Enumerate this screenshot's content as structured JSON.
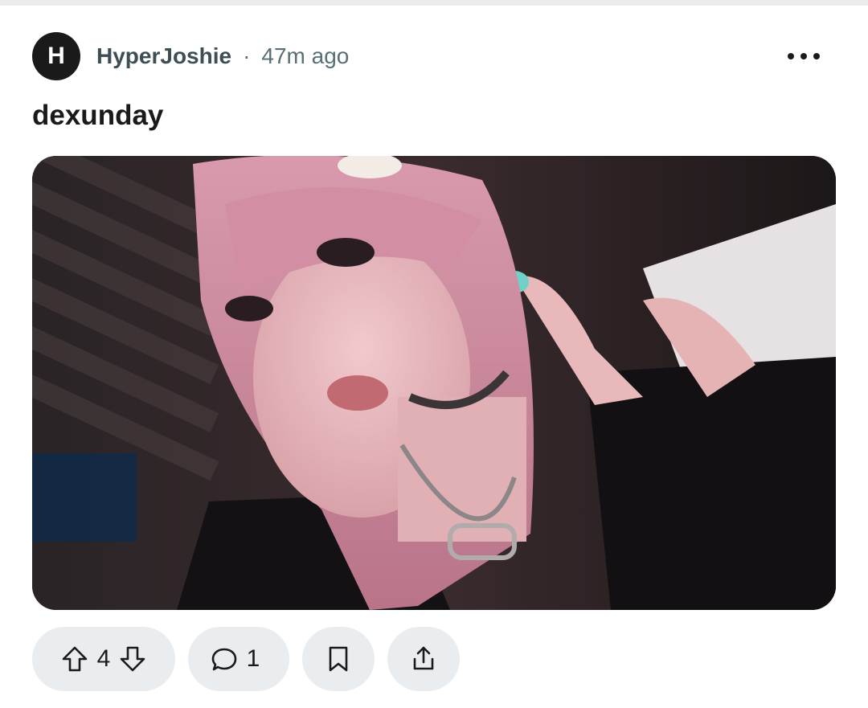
{
  "post": {
    "author_initial": "H",
    "author": "HyperJoshie",
    "separator": "·",
    "time": "47m ago",
    "title": "dexunday"
  },
  "actions": {
    "vote_count": "4",
    "comment_count": "1"
  },
  "icons": {
    "more": "more-horizontal-icon",
    "upvote": "arrow-up-icon",
    "downvote": "arrow-down-icon",
    "comment": "speech-bubble-icon",
    "save": "bookmark-icon",
    "share": "share-icon"
  },
  "colors": {
    "avatar_bg": "#1a1a1b",
    "pill_bg": "#eaedef",
    "meta_text": "#576f76"
  }
}
